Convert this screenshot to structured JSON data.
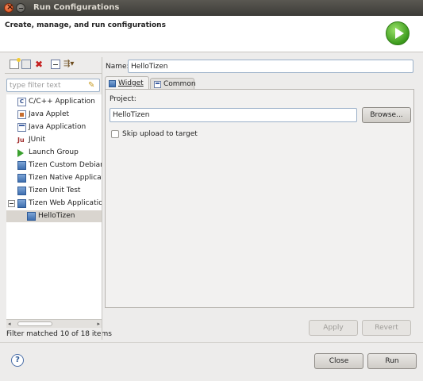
{
  "window": {
    "title": "Run Configurations"
  },
  "header": {
    "title": "Create, manage, and run configurations",
    "icon": "run-icon"
  },
  "left_panel": {
    "filter_placeholder": "type filter text",
    "tree": [
      {
        "label": "C/C++ Application",
        "icon": "c-app-icon"
      },
      {
        "label": "Java Applet",
        "icon": "java-applet-icon"
      },
      {
        "label": "Java Application",
        "icon": "java-app-icon"
      },
      {
        "label": "JUnit",
        "icon": "junit-icon"
      },
      {
        "label": "Launch Group",
        "icon": "launch-group-icon"
      },
      {
        "label": "Tizen Custom Debian P",
        "icon": "tizen-icon"
      },
      {
        "label": "Tizen Native Applicatio",
        "icon": "tizen-icon"
      },
      {
        "label": "Tizen Unit Test",
        "icon": "tizen-icon"
      },
      {
        "label": "Tizen Web Application",
        "icon": "tizen-icon",
        "expanded": true
      },
      {
        "label": "HelloTizen",
        "icon": "tizen-icon",
        "selected": true,
        "child": true
      }
    ],
    "filter_status": "Filter matched 10 of 18 items"
  },
  "right_panel": {
    "name_label": "Name:",
    "name_value": "HelloTizen",
    "tabs": [
      {
        "label": "Widget",
        "icon": "widget-icon",
        "active": true
      },
      {
        "label": "Common",
        "icon": "common-icon",
        "active": false
      }
    ],
    "project_label": "Project:",
    "project_value": "HelloTizen",
    "browse_label": "Browse...",
    "skip_label": "Skip upload to target",
    "skip_checked": false,
    "apply_label": "Apply",
    "revert_label": "Revert"
  },
  "footer": {
    "close_label": "Close",
    "run_label": "Run",
    "help_icon": "help-icon"
  }
}
